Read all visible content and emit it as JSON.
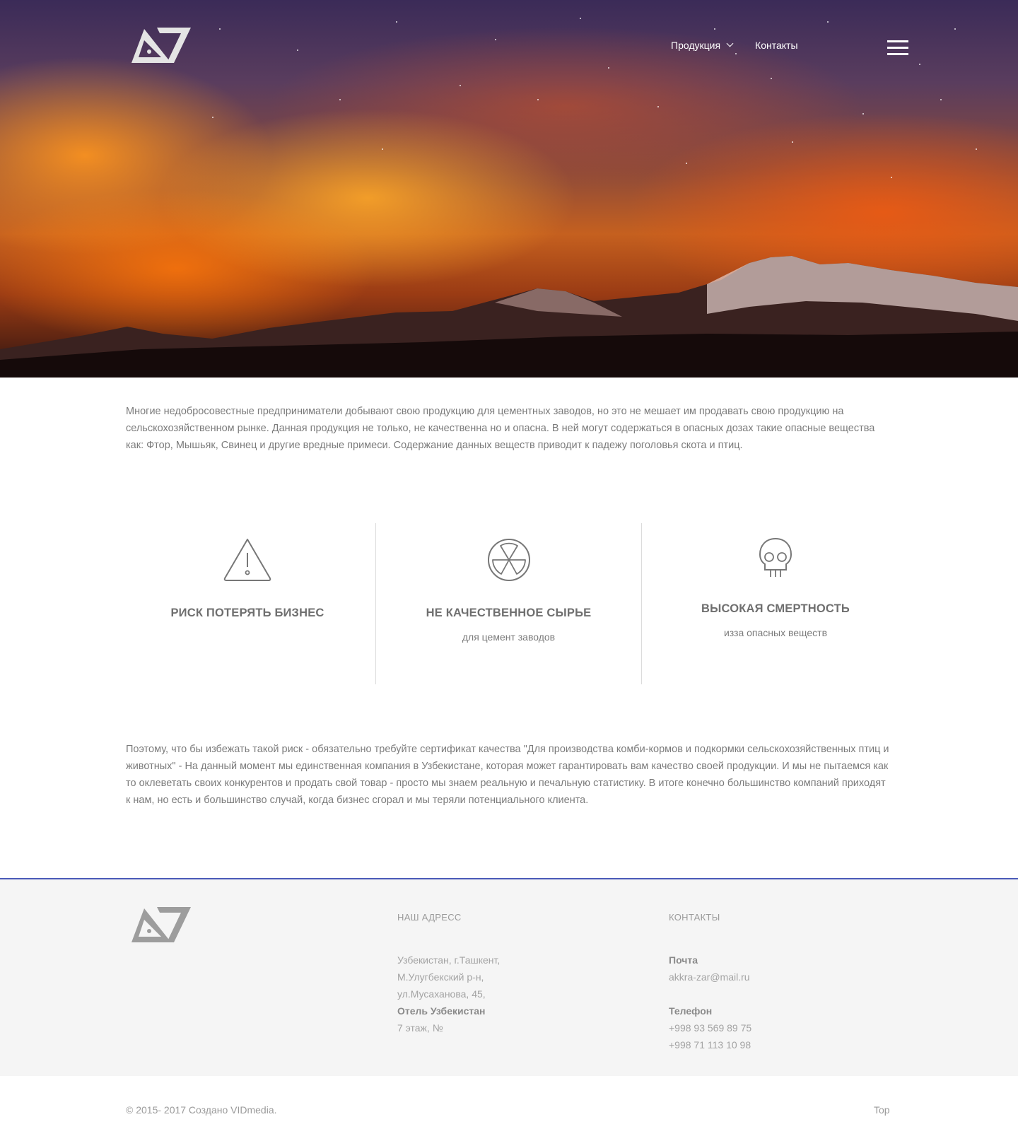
{
  "header": {
    "logo_alt": "A7",
    "nav": [
      {
        "label": "Продукция",
        "has_dropdown": true
      },
      {
        "label": "Контакты",
        "has_dropdown": false
      }
    ],
    "menu_icon": "hamburger-icon"
  },
  "intro": {
    "text": "Многие недобросовестные предприниматели добывают свою продукцию для цементных заводов, но это не мешает им продавать свою продукцию на сельскохозяйственном рынке. Данная продукция не только, не качественна но и опасна. В ней могут содержаться в опасных дозах такие опасные вещества как: Фтор, Мышьяк, Свинец и другие вредные примеси. Содержание данных веществ приводит к падежу поголовья скота и птиц."
  },
  "features": [
    {
      "icon": "warning-icon",
      "title": "РИСК ПОТЕРЯТЬ БИЗНЕС",
      "subtitle": ""
    },
    {
      "icon": "radiation-icon",
      "title": "НЕ КАЧЕСТВЕННОЕ СЫРЬЕ",
      "subtitle": "для цемент заводов"
    },
    {
      "icon": "skull-icon",
      "title": "ВЫСОКАЯ СМЕРТНОСТЬ",
      "subtitle": "изза опасных веществ"
    }
  ],
  "conclusion": {
    "text": "Поэтому, что бы избежать такой риск - обязательно требуйте сертификат качества \"Для производства комби-кормов и подкормки сельскохозяйственных птиц и животных\" - На данный момент мы единственная компания в Узбекистане, которая может гарантировать вам качество своей продукции. И мы не пытаемся как то оклеветать своих конкурентов и продать свой товар - просто мы знаем реальную и печальную статистику. В итоге конечно большинство компаний приходят к нам, но есть и большинство случай, когда бизнес сгорал и мы теряли потенциального клиента."
  },
  "footer": {
    "address_label": "НАШ АДРЕСС",
    "address_lines": [
      "Узбекистан, г.Ташкент,",
      "М.Улугбекский р-н,",
      "ул.Мусаханова, 45,"
    ],
    "address_bold": "Отель Узбекистан",
    "address_last": "7 этаж, №",
    "contacts_label": "КОНТАКТЫ",
    "mail_label": "Почта",
    "mail": "akkra-zar@mail.ru",
    "phone_label": "Телефон",
    "phones": [
      "+998 93 569 89 75",
      "+998 71 113 10 98"
    ],
    "copyright": "© 2015- 2017 Создано VIDmedia.",
    "top_link": "Top"
  },
  "colors": {
    "footer_border": "#4a5ab8",
    "text": "#7b7b7b",
    "footer_bg": "#f5f5f5"
  }
}
